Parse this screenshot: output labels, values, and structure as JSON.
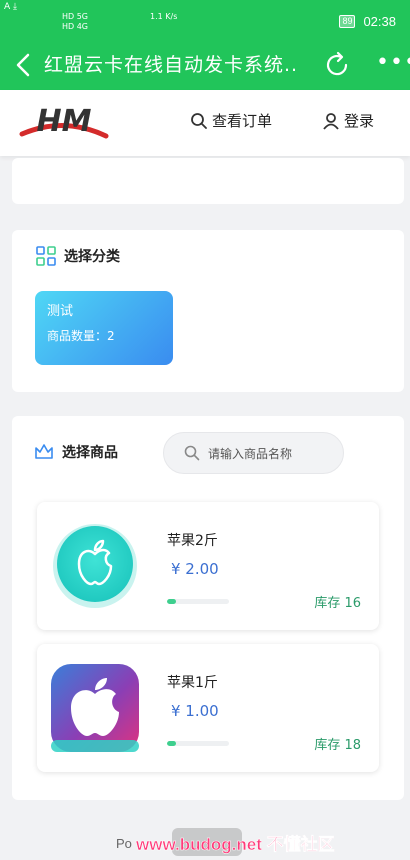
{
  "status_bar": {
    "left_icons": "A ⤓",
    "net_labels": [
      "HD 5G",
      "HD 4G"
    ],
    "speed": "1.1 K/s",
    "battery": "89",
    "time": "02:38"
  },
  "nav": {
    "title": "红盟云卡在线自动发卡系统..",
    "more": "•••"
  },
  "header": {
    "logo_text": "HM",
    "orders_label": "查看订单",
    "login_label": "登录"
  },
  "category": {
    "section_title": "选择分类",
    "items": [
      {
        "name": "测试",
        "count_label": "商品数量：2"
      }
    ]
  },
  "goods": {
    "section_title": "选择商品",
    "search_placeholder": "请输入商品名称",
    "items": [
      {
        "name": "苹果2斤",
        "price": "¥ 2.00",
        "stock": "库存 16",
        "progress": 0.15
      },
      {
        "name": "苹果1斤",
        "price": "¥ 1.00",
        "stock": "库存 18",
        "progress": 0.15
      }
    ]
  },
  "footer": {
    "text": "Po",
    "watermark": "www.budog.net 不懂社区"
  },
  "colors": {
    "brand_green": "#21c55a",
    "accent_blue": "#3b6fd1",
    "stock_green": "#2b9b6a"
  }
}
